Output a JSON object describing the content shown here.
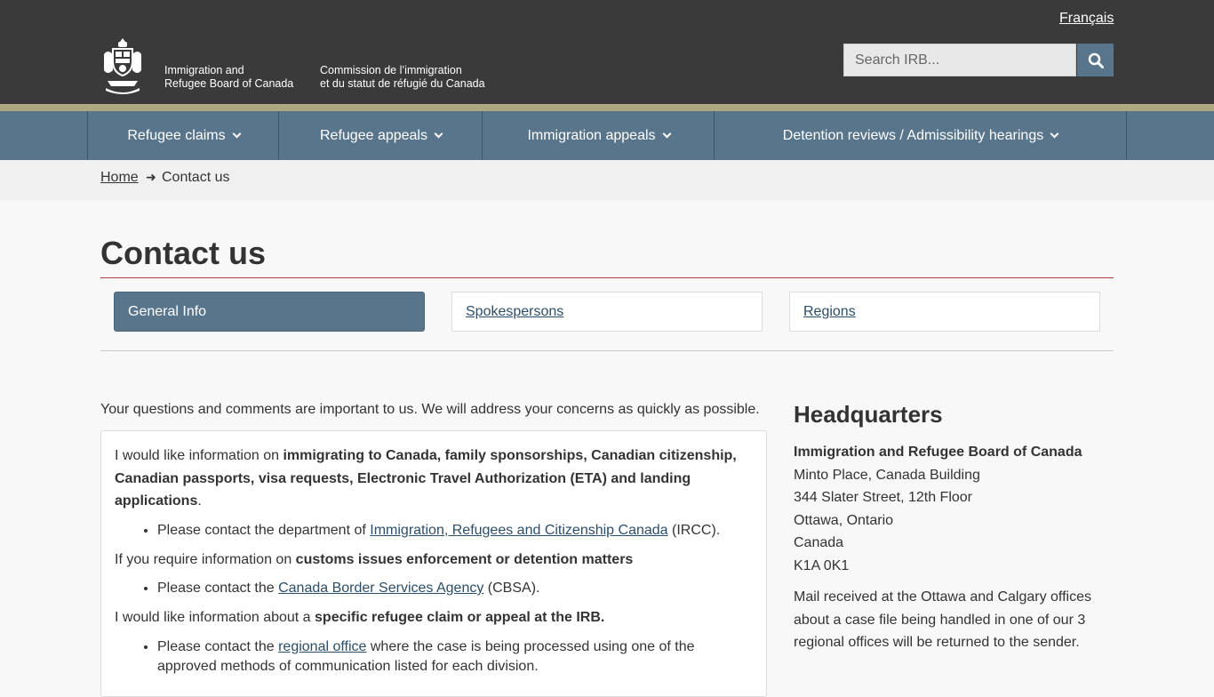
{
  "header": {
    "language_link": "Français",
    "org_name_en_line1": "Immigration and",
    "org_name_en_line2": "Refugee Board of Canada",
    "org_name_fr_line1": "Commission de l’immigration",
    "org_name_fr_line2": "et du statut de réfugié du Canada",
    "search_placeholder": "Search IRB...",
    "search_icon": "search-icon",
    "logo_icon": "coat-of-arms-icon"
  },
  "nav": {
    "items": [
      {
        "label": "Refugee claims"
      },
      {
        "label": "Refugee appeals"
      },
      {
        "label": "Immigration appeals"
      },
      {
        "label": "Detention reviews / Admissibility hearings"
      }
    ]
  },
  "breadcrumb": {
    "home": "Home",
    "separator": "➜",
    "current": "Contact us"
  },
  "page": {
    "title": "Contact us"
  },
  "tabs": [
    {
      "label": "General Info",
      "active": true
    },
    {
      "label": "Spokespersons",
      "active": false
    },
    {
      "label": "Regions",
      "active": false
    }
  ],
  "main": {
    "intro": "Your questions and comments are important to us. We will address your concerns as quickly as possible.",
    "p1_prefix": "I would like information on ",
    "p1_bold": "immigrating to Canada, family sponsorships, Canadian citizenship, Canadian passports, visa requests, Electronic Travel Authorization (ETA) and landing applications",
    "p1_suffix": ".",
    "li1_prefix": "Please contact the department of ",
    "li1_link": "Immigration, Refugees and Citizenship Canada",
    "li1_suffix": " (IRCC).",
    "p2_prefix": "If you require information on ",
    "p2_bold": "customs issues enforcement or detention matters",
    "li2_prefix": "Please contact the ",
    "li2_link": "Canada Border Services Agency",
    "li2_suffix": " (CBSA).",
    "p3_prefix": "I would like information about a ",
    "p3_bold": "specific refugee claim or appeal at the IRB.",
    "li3_prefix": "Please contact the ",
    "li3_link": "regional office",
    "li3_suffix": " where the case is being processed using one of the approved methods of communication listed for each division."
  },
  "sidebar": {
    "title": "Headquarters",
    "org": "Immigration and Refugee Board of Canada",
    "address": [
      "Minto Place, Canada Building",
      "344 Slater Street, 12th Floor",
      "Ottawa, Ontario",
      "Canada",
      "K1A 0K1"
    ],
    "note": "Mail received at the Ottawa and Calgary offices about a case file being handled in one of our 3 regional offices will be returned to the sender."
  },
  "colors": {
    "header_bg": "#3a3a3a",
    "accent_strip": "#aea980",
    "nav_bg": "#59758b",
    "title_rule": "#af3c43",
    "link": "#2b4e6a"
  }
}
